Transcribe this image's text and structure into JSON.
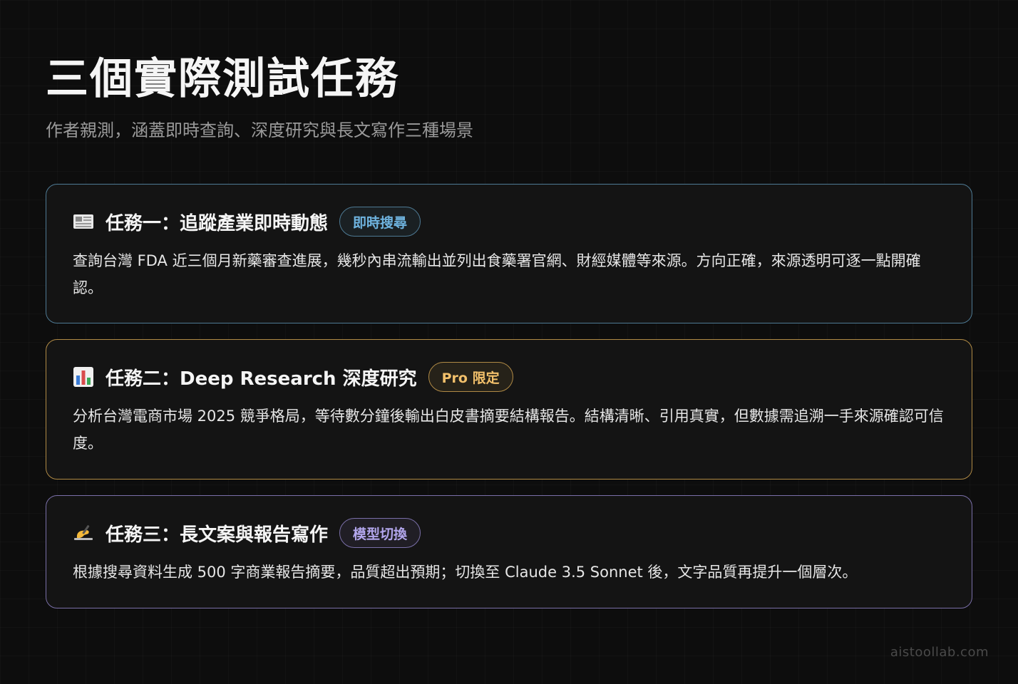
{
  "header": {
    "title": "三個實際測試任務",
    "subtitle": "作者親測，涵蓋即時查詢、深度研究與長文寫作三種場景"
  },
  "cards": [
    {
      "icon": "newspaper-icon",
      "title": "任務一：追蹤產業即時動態",
      "tag": "即時搜尋",
      "accent": "#4e7a94",
      "body": "查詢台灣 FDA 近三個月新藥審查進展，幾秒內串流輸出並列出食藥署官網、財經媒體等來源。方向正確，來源透明可逐一點開確認。"
    },
    {
      "icon": "bar-chart-icon",
      "title": "任務二：Deep Research 深度研究",
      "tag": "Pro 限定",
      "accent": "#b08a45",
      "body": "分析台灣電商市場 2025 競爭格局，等待數分鐘後輸出白皮書摘要結構報告。結構清晰、引用真實，但數據需追溯一手來源確認可信度。"
    },
    {
      "icon": "writing-hand-icon",
      "title": "任務三：長文案與報告寫作",
      "tag": "模型切換",
      "accent": "#7a6fa8",
      "body": "根據搜尋資料生成 500 字商業報告摘要，品質超出預期；切換至 Claude 3.5 Sonnet 後，文字品質再提升一個層次。"
    }
  ],
  "footer": {
    "watermark": "aistoollab.com"
  }
}
